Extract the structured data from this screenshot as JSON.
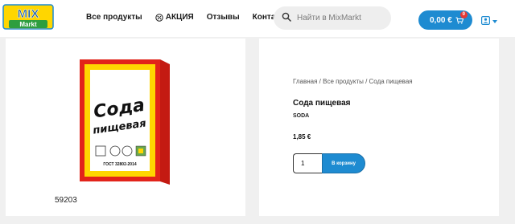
{
  "header": {
    "logo": {
      "line1": "MIX",
      "line2": "Markt"
    },
    "nav": [
      {
        "label": "Все продукты",
        "icon": ""
      },
      {
        "label": "АКЦИЯ",
        "icon": "percent-icon"
      },
      {
        "label": "Отзывы",
        "icon": ""
      },
      {
        "label": "Контакты",
        "icon": ""
      }
    ],
    "search": {
      "placeholder": "Найти в MixMarkt",
      "value": ""
    },
    "cart": {
      "total": "0,00 €",
      "count": "0"
    },
    "colors": {
      "accent": "#1e8bd1",
      "badge": "#e53935"
    }
  },
  "product": {
    "image": {
      "label_line1": "Сода",
      "label_line2": "пищевая",
      "standard": "ГОСТ 32802-2014",
      "colors": {
        "frame": "#e2231a",
        "outer": "#ffd600",
        "inner": "#ffffff"
      }
    },
    "sku": "59203",
    "breadcrumb": [
      "Главная",
      "Все продукты",
      "Сода пищевая"
    ],
    "breadcrumb_separator": " / ",
    "title": "Сода пищевая",
    "brand": "SODA",
    "price": "1,85 €",
    "quantity": "1",
    "add_to_cart_label": "В корзину"
  }
}
